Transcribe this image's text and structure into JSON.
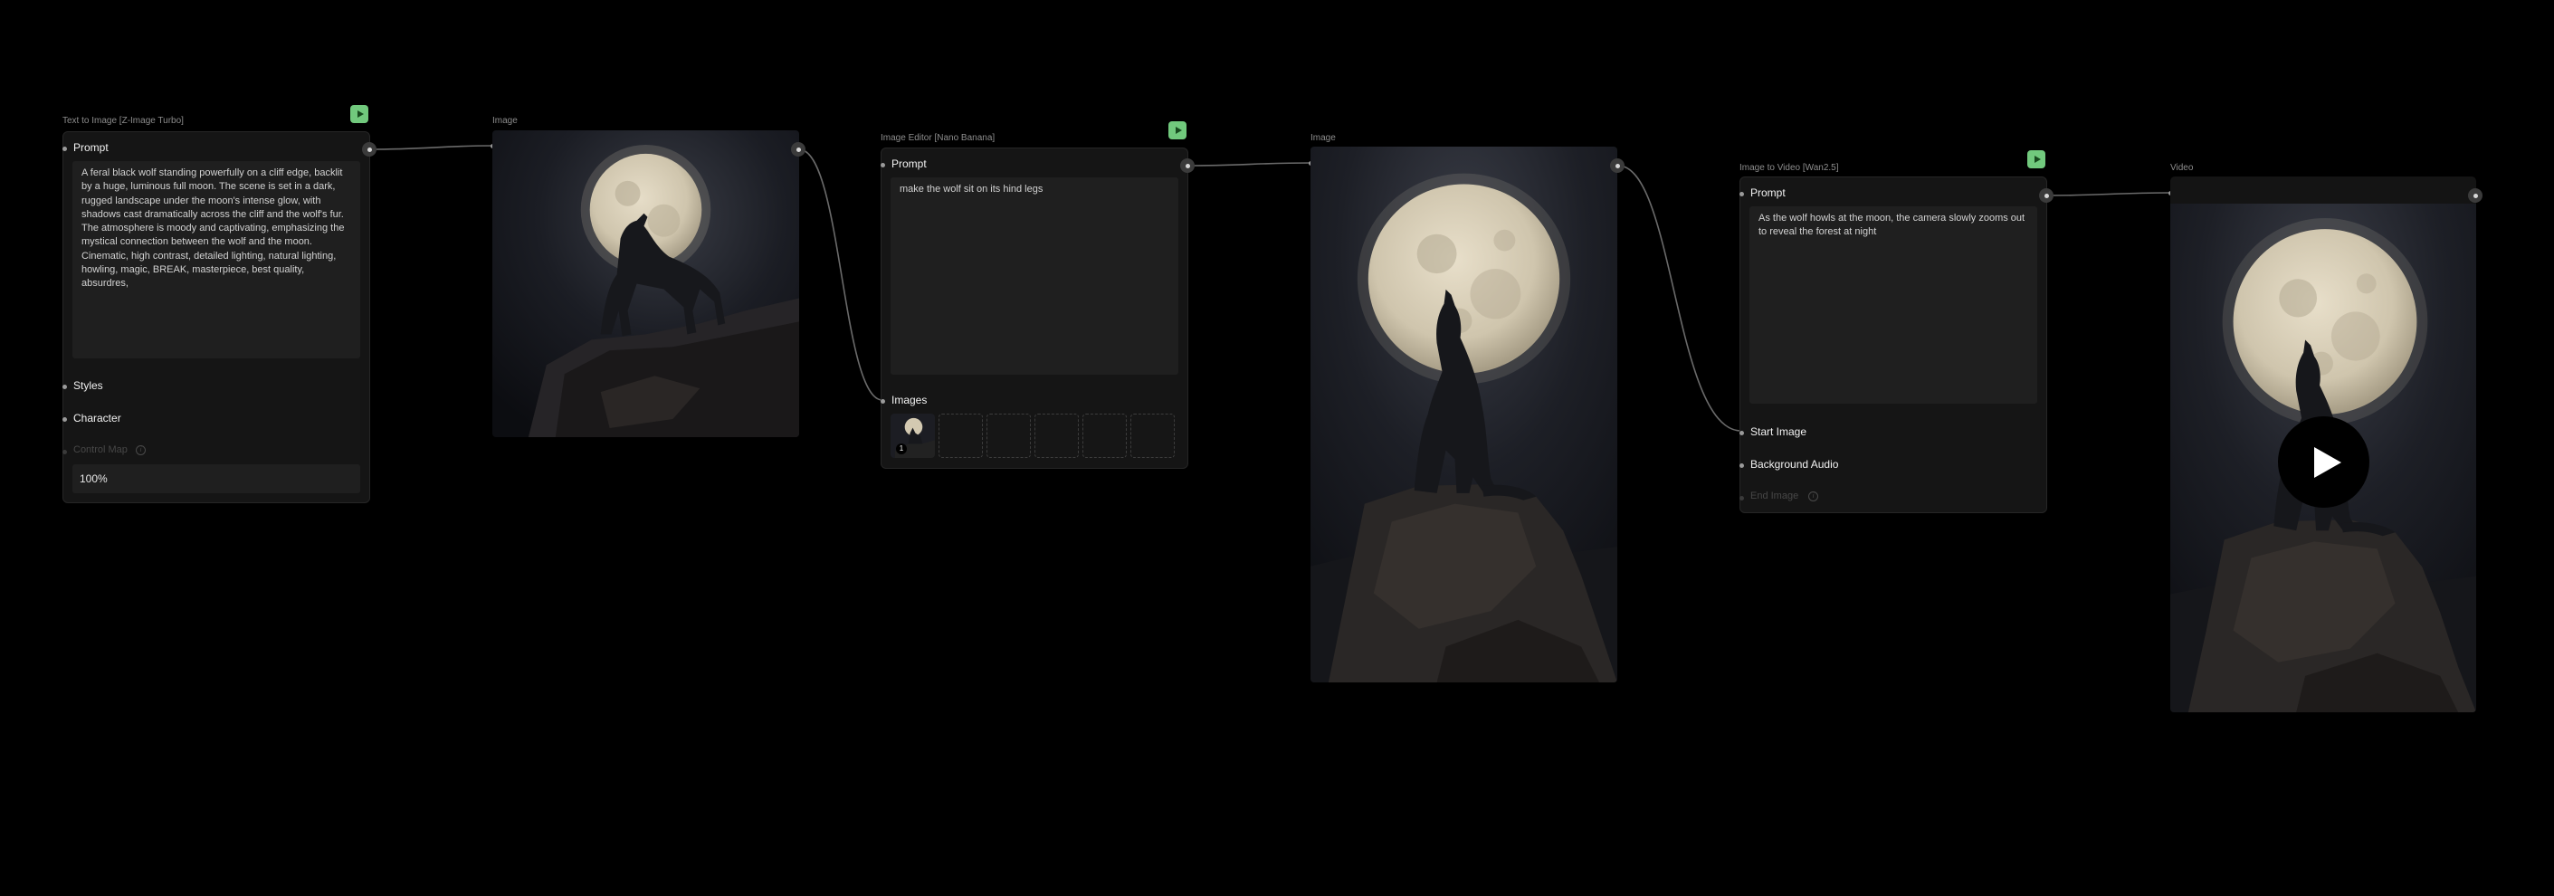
{
  "colors": {
    "canvas": "#000000",
    "node": "#151515",
    "field": "#1f1f1f",
    "run": "#71c97d"
  },
  "node1": {
    "title": "Text to Image [Z-Image Turbo]",
    "prompt_label": "Prompt",
    "prompt_text": "A feral black wolf standing powerfully on a cliff edge, backlit by a huge, luminous full moon. The scene is set in a dark, rugged landscape under the moon's intense glow, with shadows cast dramatically across the cliff and the wolf's fur. The atmosphere is moody and captivating, emphasizing the mystical connection between the wolf and the moon. Cinematic, high contrast, detailed lighting, natural lighting, howling, magic, BREAK, masterpiece, best quality, absurdres,",
    "styles_label": "Styles",
    "character_label": "Character",
    "control_label": "Control Map",
    "strength_value": "100%",
    "run_icon": "play-icon"
  },
  "image1": {
    "title": "Image"
  },
  "node2": {
    "title": "Image Editor [Nano Banana]",
    "prompt_label": "Prompt",
    "prompt_text": "make the wolf sit on its hind legs",
    "images_label": "Images",
    "thumb_badge": "1"
  },
  "image2": {
    "title": "Image"
  },
  "node3": {
    "title": "Image to Video [Wan2.5]",
    "prompt_label": "Prompt",
    "prompt_text": "As the wolf howls at the moon, the camera slowly zooms out to reveal the forest at night",
    "start_label": "Start Image",
    "audio_label": "Background Audio",
    "end_label": "End Image"
  },
  "video": {
    "title": "Video",
    "play_icon": "play-circle-icon"
  }
}
